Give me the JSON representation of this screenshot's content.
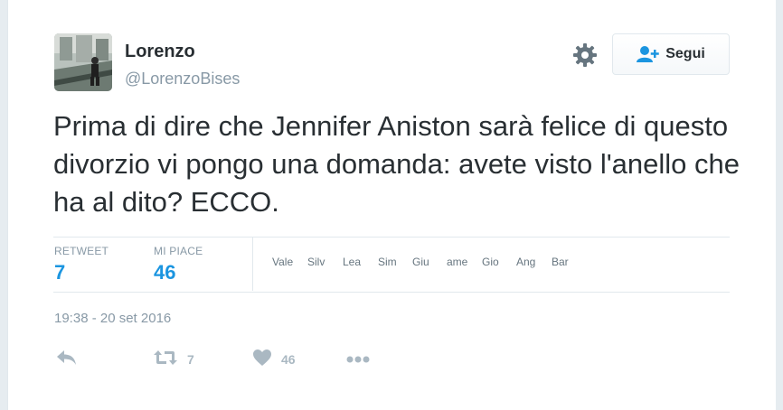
{
  "user": {
    "name": "Lorenzo",
    "handle": "@LorenzoBises"
  },
  "follow_button": {
    "label": "Segui"
  },
  "tweet": {
    "text": "Prima di dire che Jennifer Aniston sarà felice di questo divorzio vi pongo una domanda: avete visto l'anello che ha al dito? ECCO."
  },
  "stats": {
    "retweet_label": "RETWEET",
    "retweet_count": "7",
    "likes_label": "MI PIACE",
    "likes_count": "46"
  },
  "likers": [
    "Vale",
    "Silv",
    "Lea",
    "Sim",
    "Giu",
    "ame",
    "Gio",
    "Ang",
    "Bar"
  ],
  "timestamp": "19:38 - 20 set 2016",
  "actions": {
    "retweet_count": "7",
    "like_count": "46"
  },
  "colors": {
    "accent": "#1b95e0",
    "muted": "#8899a6",
    "icon": "#aab8c2",
    "text": "#292f33"
  }
}
